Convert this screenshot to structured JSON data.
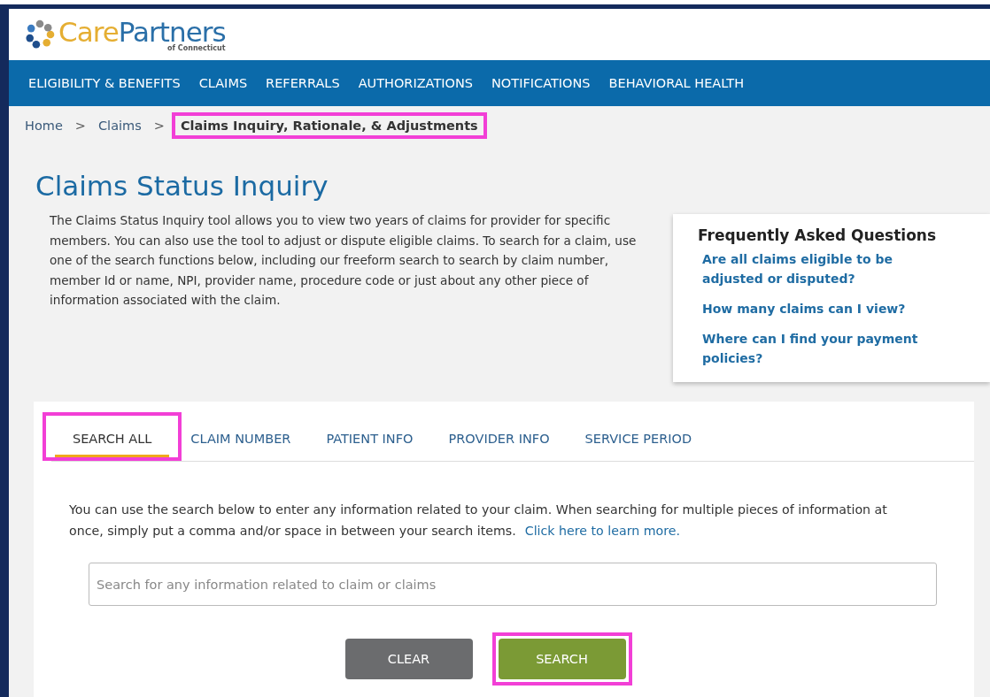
{
  "brand": {
    "name_part_1": "Care",
    "name_part_2": "Partners",
    "tagline": "of Connecticut"
  },
  "nav": [
    "ELIGIBILITY & BENEFITS",
    "CLAIMS",
    "REFERRALS",
    "AUTHORIZATIONS",
    "NOTIFICATIONS",
    "BEHAVIORAL HEALTH"
  ],
  "breadcrumb": [
    {
      "label": "Home",
      "current": false,
      "highlighted": false
    },
    {
      "label": "Claims",
      "current": false,
      "highlighted": false
    },
    {
      "label": "Claims Inquiry, Rationale, & Adjustments",
      "current": true,
      "highlighted": true
    }
  ],
  "breadcrumb_separator": ">",
  "page_title": "Claims Status Inquiry",
  "intro": "The Claims Status Inquiry tool allows you to view two years of claims for provider for specific members. You can also use the tool to adjust or dispute eligible claims. To search for a claim, use one of the search functions below, including our freeform search to search by claim number, member Id or name, NPI, provider name, procedure code or just about any other piece of information associated with the claim.",
  "faq": {
    "title": "Frequently Asked Questions",
    "links": [
      "Are all claims eligible to be adjusted or disputed?",
      "How many claims can I view?",
      "Where can I find your payment policies?"
    ]
  },
  "tabs": [
    {
      "label": "SEARCH ALL",
      "selected": true,
      "highlighted": true
    },
    {
      "label": "CLAIM NUMBER",
      "selected": false,
      "highlighted": false
    },
    {
      "label": "PATIENT INFO",
      "selected": false,
      "highlighted": false
    },
    {
      "label": "PROVIDER INFO",
      "selected": false,
      "highlighted": false
    },
    {
      "label": "SERVICE PERIOD",
      "selected": false,
      "highlighted": false
    }
  ],
  "search_help": {
    "text": "You can use the search below to enter any information related to your claim. When searching for multiple pieces of information at once, simply put a comma and/or space in between your search items.",
    "link": "Click here to learn more."
  },
  "search": {
    "placeholder": "Search for any information related to claim or claims"
  },
  "buttons": [
    {
      "label": "CLEAR",
      "kind": "secondary",
      "highlighted": false
    },
    {
      "label": "SEARCH",
      "kind": "primary",
      "highlighted": true
    }
  ]
}
